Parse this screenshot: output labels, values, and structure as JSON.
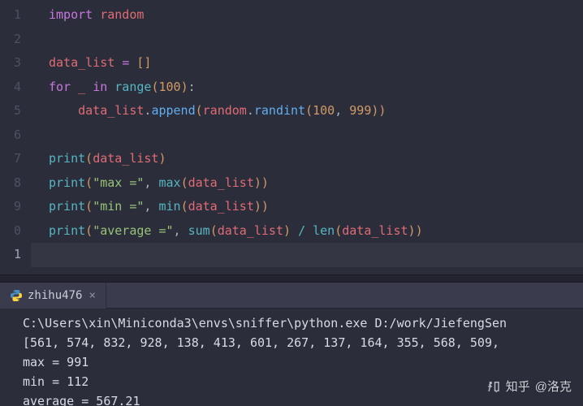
{
  "editor": {
    "line_numbers": [
      "1",
      "2",
      "3",
      "4",
      "5",
      "6",
      "7",
      "8",
      "9",
      "0",
      "1"
    ],
    "code_lines": [
      [
        {
          "c": "kw",
          "t": "import "
        },
        {
          "c": "var",
          "t": "random"
        }
      ],
      [],
      [
        {
          "c": "var",
          "t": "data_list"
        },
        {
          "c": "plain",
          "t": " "
        },
        {
          "c": "eq",
          "t": "="
        },
        {
          "c": "plain",
          "t": " "
        },
        {
          "c": "br",
          "t": "["
        },
        {
          "c": "br",
          "t": "]"
        }
      ],
      [
        {
          "c": "kw",
          "t": "for "
        },
        {
          "c": "var",
          "t": "_"
        },
        {
          "c": "plain",
          "t": " "
        },
        {
          "c": "kw",
          "t": "in "
        },
        {
          "c": "built",
          "t": "range"
        },
        {
          "c": "pn",
          "t": "("
        },
        {
          "c": "num",
          "t": "100"
        },
        {
          "c": "pn",
          "t": ")"
        },
        {
          "c": "plain",
          "t": ":"
        }
      ],
      [
        {
          "c": "plain",
          "t": "    "
        },
        {
          "c": "var",
          "t": "data_list"
        },
        {
          "c": "plain",
          "t": "."
        },
        {
          "c": "attr",
          "t": "append"
        },
        {
          "c": "br",
          "t": "("
        },
        {
          "c": "var",
          "t": "random"
        },
        {
          "c": "plain",
          "t": "."
        },
        {
          "c": "attr",
          "t": "randint"
        },
        {
          "c": "pn",
          "t": "("
        },
        {
          "c": "num",
          "t": "100"
        },
        {
          "c": "plain",
          "t": ", "
        },
        {
          "c": "num",
          "t": "999"
        },
        {
          "c": "pn",
          "t": ")"
        },
        {
          "c": "br",
          "t": ")"
        }
      ],
      [],
      [
        {
          "c": "built",
          "t": "print"
        },
        {
          "c": "pn",
          "t": "("
        },
        {
          "c": "var",
          "t": "data_list"
        },
        {
          "c": "pn",
          "t": ")"
        }
      ],
      [
        {
          "c": "built",
          "t": "print"
        },
        {
          "c": "pn",
          "t": "("
        },
        {
          "c": "str",
          "t": "\"max =\""
        },
        {
          "c": "plain",
          "t": ", "
        },
        {
          "c": "built",
          "t": "max"
        },
        {
          "c": "br",
          "t": "("
        },
        {
          "c": "var",
          "t": "data_list"
        },
        {
          "c": "br",
          "t": ")"
        },
        {
          "c": "pn",
          "t": ")"
        }
      ],
      [
        {
          "c": "built",
          "t": "print"
        },
        {
          "c": "pn",
          "t": "("
        },
        {
          "c": "str",
          "t": "\"min =\""
        },
        {
          "c": "plain",
          "t": ", "
        },
        {
          "c": "built",
          "t": "min"
        },
        {
          "c": "br",
          "t": "("
        },
        {
          "c": "var",
          "t": "data_list"
        },
        {
          "c": "br",
          "t": ")"
        },
        {
          "c": "pn",
          "t": ")"
        }
      ],
      [
        {
          "c": "built",
          "t": "print"
        },
        {
          "c": "pn",
          "t": "("
        },
        {
          "c": "str",
          "t": "\"average =\""
        },
        {
          "c": "plain",
          "t": ", "
        },
        {
          "c": "built",
          "t": "sum"
        },
        {
          "c": "br",
          "t": "("
        },
        {
          "c": "var",
          "t": "data_list"
        },
        {
          "c": "br",
          "t": ")"
        },
        {
          "c": "plain",
          "t": " "
        },
        {
          "c": "op",
          "t": "/"
        },
        {
          "c": "plain",
          "t": " "
        },
        {
          "c": "built",
          "t": "len"
        },
        {
          "c": "pn",
          "t": "("
        },
        {
          "c": "var",
          "t": "data_list"
        },
        {
          "c": "pn",
          "t": ")"
        },
        {
          "c": "pn",
          "t": ")"
        }
      ],
      []
    ],
    "current_line_index": 10
  },
  "terminal": {
    "tab_label": "zhihu476",
    "output_lines": [
      "C:\\Users\\xin\\Miniconda3\\envs\\sniffer\\python.exe D:/work/JiefengSen",
      "[561, 574, 832, 928, 138, 413, 601, 267, 137, 164, 355, 568, 509, ",
      "max = 991",
      "min = 112",
      "average = 567.21"
    ]
  },
  "watermark": {
    "site": "知乎",
    "at": "@洛克"
  }
}
